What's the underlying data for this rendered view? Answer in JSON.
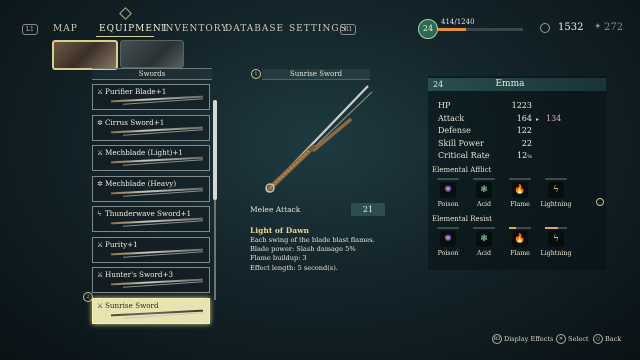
{
  "nav": {
    "left_hint": "L1",
    "right_hint": "R1",
    "tabs": [
      "MAP",
      "EQUIPMENT",
      "INVENTORY",
      "DATABASE",
      "SETTINGS"
    ],
    "active_tab": "EQUIPMENT"
  },
  "status": {
    "level": "24",
    "xp": "414/1240",
    "xp_fraction": 0.33,
    "gold": "1532",
    "gems": "272"
  },
  "list": {
    "header": "Swords",
    "badge": "2",
    "items": [
      {
        "name": "Purifier Blade+1",
        "icon": "sword-icon"
      },
      {
        "name": "Cirrus Sword+1",
        "icon": "gear-icon"
      },
      {
        "name": "Mechblade (Light)+1",
        "icon": "sword-icon"
      },
      {
        "name": "Mechblade (Heavy)",
        "icon": "gear-icon"
      },
      {
        "name": "Thunderwave Sword+1",
        "icon": "lightning-icon"
      },
      {
        "name": "Purity+1",
        "icon": "sword-icon"
      },
      {
        "name": "Hunter's Sword+3",
        "icon": "sword-icon"
      },
      {
        "name": "Sunrise Sword",
        "icon": "sword-icon"
      }
    ],
    "selected_index": 7
  },
  "detail": {
    "badge": "1",
    "title": "Sunrise Sword",
    "stat_label": "Melee Attack",
    "stat_value": "21",
    "skill_title": "Light of Dawn",
    "skill_lines": [
      "Each swing of the blade blast flames.",
      "Blade power: Slash damage 5%",
      "Flame buildup: 3",
      "Effect length: 5 second(s)."
    ]
  },
  "character": {
    "level": "24",
    "name": "Emma",
    "stats": [
      {
        "label": "HP",
        "value": "1223"
      },
      {
        "label": "Attack",
        "value": "164",
        "new_value": "134"
      },
      {
        "label": "Defense",
        "value": "122"
      },
      {
        "label": "Skill Power",
        "value": "22"
      },
      {
        "label": "Critical Rate",
        "value": "12",
        "unit": "%"
      }
    ],
    "afflict_title": "Elemental Afflict",
    "resist_title": "Elemental Resist",
    "elements": [
      "Poison",
      "Acid",
      "Flame",
      "Lightning"
    ],
    "element_colors": [
      "#b48ad8",
      "#7ec49a",
      "#e0685a",
      "#e3d36a"
    ],
    "afflict_levels": [
      0.0,
      0.0,
      0.0,
      0.0
    ],
    "resist_levels": [
      0.0,
      0.0,
      0.3,
      0.6
    ]
  },
  "hints": [
    {
      "key": "R3",
      "label": "Display Effects"
    },
    {
      "key": "✕",
      "label": "Select"
    },
    {
      "key": "○",
      "label": "Back"
    }
  ]
}
